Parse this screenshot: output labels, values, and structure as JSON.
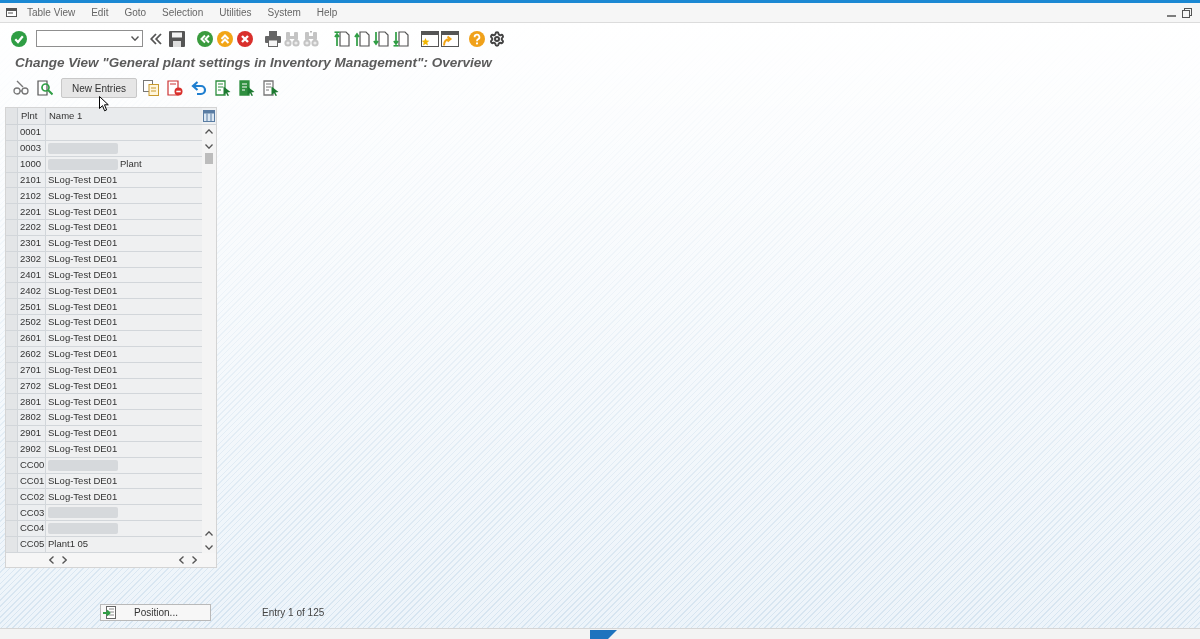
{
  "menu_bar": {
    "items": [
      "Table View",
      "Edit",
      "Goto",
      "Selection",
      "Utilities",
      "System",
      "Help"
    ]
  },
  "title": "Change View \"General plant settings in Inventory Management\": Overview",
  "application_toolbar": {
    "new_entries_button": "New Entries"
  },
  "table": {
    "columns": [
      "Plnt",
      "Name 1"
    ],
    "rows": [
      {
        "plnt": "0001",
        "redacted": false
      },
      {
        "plnt": "0003",
        "redacted": true
      },
      {
        "plnt": "1000",
        "redacted": true,
        "name_1": "Plant"
      },
      {
        "plnt": "2101",
        "redacted": false,
        "name_1": "SLog-Test DE01"
      },
      {
        "plnt": "2102",
        "redacted": false,
        "name_1": "SLog-Test DE01"
      },
      {
        "plnt": "2201",
        "redacted": false,
        "name_1": "SLog-Test DE01"
      },
      {
        "plnt": "2202",
        "redacted": false,
        "name_1": "SLog-Test DE01"
      },
      {
        "plnt": "2301",
        "redacted": false,
        "name_1": "SLog-Test DE01"
      },
      {
        "plnt": "2302",
        "redacted": false,
        "name_1": "SLog-Test DE01"
      },
      {
        "plnt": "2401",
        "redacted": false,
        "name_1": "SLog-Test DE01"
      },
      {
        "plnt": "2402",
        "redacted": false,
        "name_1": "SLog-Test DE01"
      },
      {
        "plnt": "2501",
        "redacted": false,
        "name_1": "SLog-Test DE01"
      },
      {
        "plnt": "2502",
        "redacted": false,
        "name_1": "SLog-Test DE01"
      },
      {
        "plnt": "2601",
        "redacted": false,
        "name_1": "SLog-Test DE01"
      },
      {
        "plnt": "2602",
        "redacted": false,
        "name_1": "SLog-Test DE01"
      },
      {
        "plnt": "2701",
        "redacted": false,
        "name_1": "SLog-Test DE01"
      },
      {
        "plnt": "2702",
        "redacted": false,
        "name_1": "SLog-Test DE01"
      },
      {
        "plnt": "2801",
        "redacted": false,
        "name_1": "SLog-Test DE01"
      },
      {
        "plnt": "2802",
        "redacted": false,
        "name_1": "SLog-Test DE01"
      },
      {
        "plnt": "2901",
        "redacted": false,
        "name_1": "SLog-Test DE01"
      },
      {
        "plnt": "2902",
        "redacted": false,
        "name_1": "SLog-Test DE01"
      },
      {
        "plnt": "CC00",
        "redacted": true
      },
      {
        "plnt": "CC01",
        "redacted": false,
        "name_1": "SLog-Test DE01"
      },
      {
        "plnt": "CC02",
        "redacted": false,
        "name_1": "SLog-Test DE01"
      },
      {
        "plnt": "CC03",
        "redacted": true
      },
      {
        "plnt": "CC04",
        "redacted": true
      },
      {
        "plnt": "CC05",
        "redacted": false,
        "name_1": "Plant1 05"
      }
    ]
  },
  "footer": {
    "position_button": "Position...",
    "entry_info": "Entry 1 of 125"
  }
}
